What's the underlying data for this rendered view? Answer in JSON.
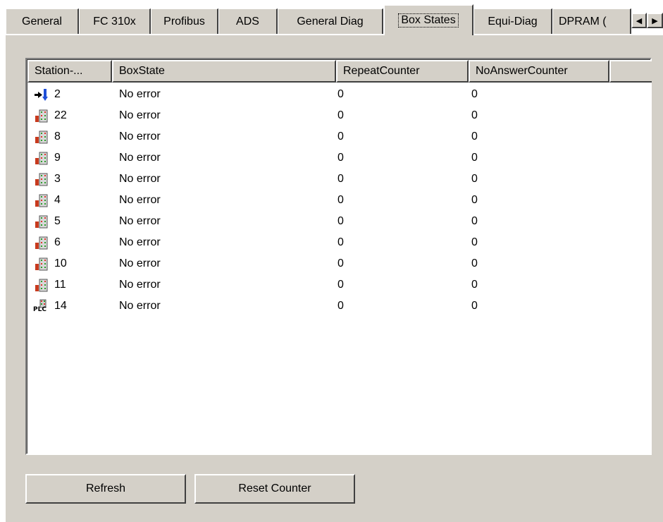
{
  "tabs": [
    {
      "label": "General",
      "active": false
    },
    {
      "label": "FC 310x",
      "active": false
    },
    {
      "label": "Profibus",
      "active": false
    },
    {
      "label": "ADS",
      "active": false
    },
    {
      "label": "General Diag",
      "active": false
    },
    {
      "label": "Box States",
      "active": true
    },
    {
      "label": "Equi-Diag",
      "active": false
    },
    {
      "label": "DPRAM (",
      "active": false
    }
  ],
  "scroll": {
    "left_icon": "scroll-left-icon",
    "right_icon": "scroll-right-icon"
  },
  "table": {
    "columns": [
      "Station-...",
      "BoxState",
      "RepeatCounter",
      "NoAnswerCounter"
    ],
    "rows": [
      {
        "icon": "master-icon",
        "station": "2",
        "state": "No error",
        "repeat": "0",
        "noanswer": "0"
      },
      {
        "icon": "io-box-icon",
        "station": "22",
        "state": "No error",
        "repeat": "0",
        "noanswer": "0"
      },
      {
        "icon": "io-box-icon",
        "station": "8",
        "state": "No error",
        "repeat": "0",
        "noanswer": "0"
      },
      {
        "icon": "io-box-icon",
        "station": "9",
        "state": "No error",
        "repeat": "0",
        "noanswer": "0"
      },
      {
        "icon": "io-box-icon",
        "station": "3",
        "state": "No error",
        "repeat": "0",
        "noanswer": "0"
      },
      {
        "icon": "io-box-icon",
        "station": "4",
        "state": "No error",
        "repeat": "0",
        "noanswer": "0"
      },
      {
        "icon": "io-box-icon",
        "station": "5",
        "state": "No error",
        "repeat": "0",
        "noanswer": "0"
      },
      {
        "icon": "io-box-icon",
        "station": "6",
        "state": "No error",
        "repeat": "0",
        "noanswer": "0"
      },
      {
        "icon": "io-box-icon",
        "station": "10",
        "state": "No error",
        "repeat": "0",
        "noanswer": "0"
      },
      {
        "icon": "io-box-icon",
        "station": "11",
        "state": "No error",
        "repeat": "0",
        "noanswer": "0"
      },
      {
        "icon": "plc-box-icon",
        "station": "14",
        "state": "No error",
        "repeat": "0",
        "noanswer": "0",
        "icon_text": "PLC"
      }
    ]
  },
  "buttons": {
    "refresh": "Refresh",
    "reset": "Reset Counter"
  }
}
